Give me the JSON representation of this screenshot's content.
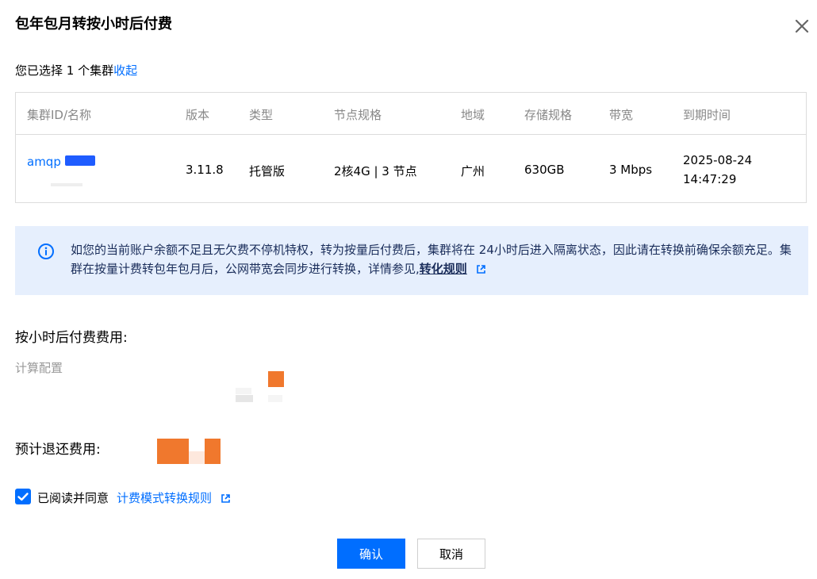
{
  "dialog": {
    "title": "包年包月转按小时后付费",
    "close_icon": "close-icon"
  },
  "selection": {
    "prefix": "您已选择 1 个集群",
    "collapse_link": "收起"
  },
  "table": {
    "columns": [
      "集群ID/名称",
      "版本",
      "类型",
      "节点规格",
      "地域",
      "存储规格",
      "带宽",
      "到期时间"
    ],
    "rows": [
      {
        "cluster_id": "amqp",
        "version": "3.11.8",
        "type": "托管版",
        "node_spec": "2核4G | 3 节点",
        "region": "广州",
        "storage": "630GB",
        "bandwidth": "3 Mbps",
        "expire_date": "2025-08-24",
        "expire_time": "14:47:29"
      }
    ]
  },
  "notice": {
    "icon": "info-icon",
    "text": "如您的当前账户余额不足且无欠费不停机特权，转为按量后付费后，集群将在 24小时后进入隔离状态，因此请在转换前确保余额充足。集群在按量计费转包年包月后，公网带宽会同步进行转换，详情参见,",
    "link": "转化规则",
    "link_icon": "external-link-icon"
  },
  "pricing": {
    "hourly_title": "按小时后付费费用:",
    "compute_label": "计算配置",
    "refund_title": "预计退还费用:"
  },
  "agreement": {
    "checked": true,
    "label": "已阅读并同意",
    "link": "计费模式转换规则",
    "link_icon": "external-link-icon"
  },
  "buttons": {
    "confirm": "确认",
    "cancel": "取消"
  },
  "colors": {
    "accent": "#006eff",
    "notice_bg": "#e6effd",
    "price_highlight": "#f0782d"
  }
}
